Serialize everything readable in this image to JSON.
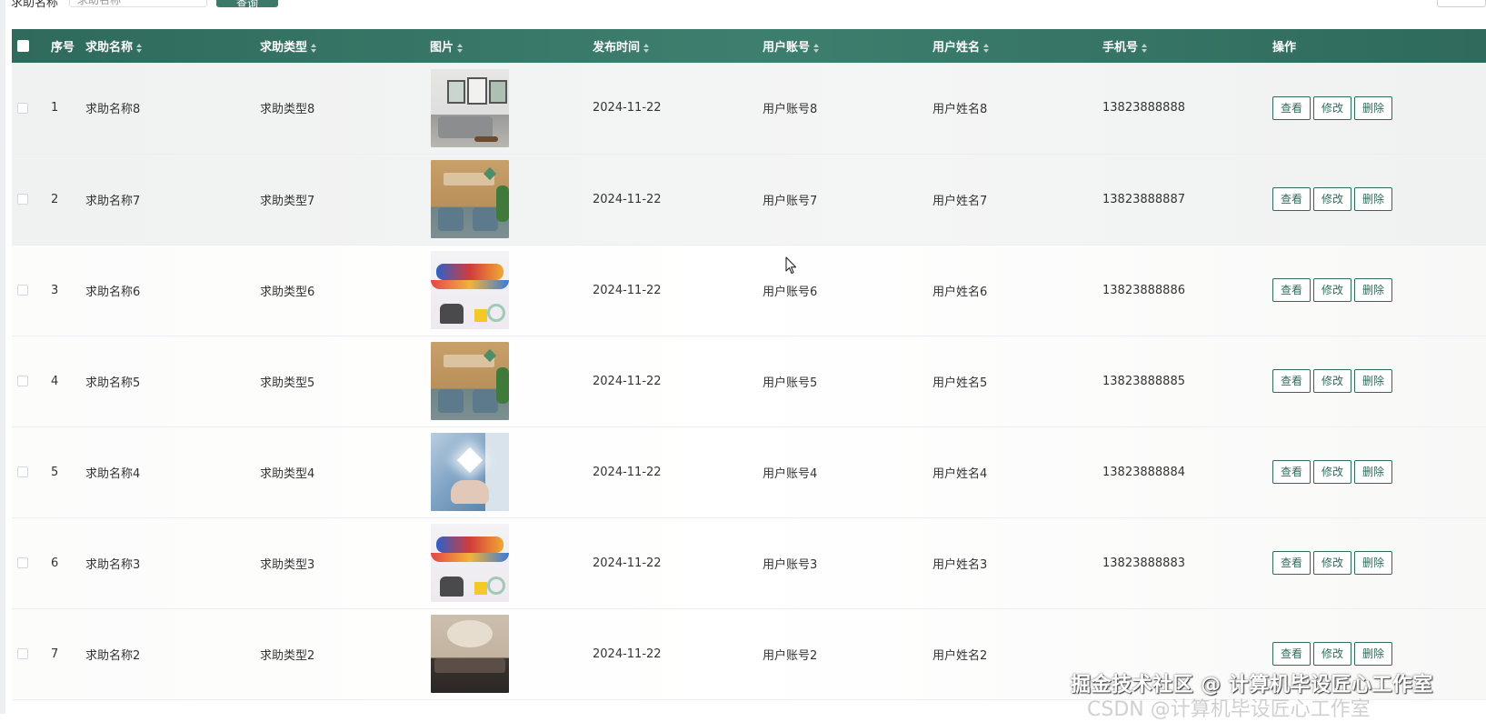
{
  "toolbar": {
    "search_label": "求助名称",
    "search_placeholder": "求助名称",
    "search_button": "查询"
  },
  "table": {
    "columns": [
      {
        "key": "index",
        "label": "序号",
        "sortable": false
      },
      {
        "key": "name",
        "label": "求助名称",
        "sortable": true
      },
      {
        "key": "type",
        "label": "求助类型",
        "sortable": true
      },
      {
        "key": "picture",
        "label": "图片",
        "sortable": true
      },
      {
        "key": "publish_time",
        "label": "发布时间",
        "sortable": true
      },
      {
        "key": "account",
        "label": "用户账号",
        "sortable": true
      },
      {
        "key": "username",
        "label": "用户姓名",
        "sortable": true
      },
      {
        "key": "phone",
        "label": "手机号",
        "sortable": true
      },
      {
        "key": "operations",
        "label": "操作",
        "sortable": false
      }
    ],
    "rows": [
      {
        "index": "1",
        "name": "求助名称8",
        "type": "求助类型8",
        "picture": "sofa-room-photo",
        "publish_time": "2024-11-22",
        "account": "用户账号8",
        "username": "用户姓名8",
        "phone": "13823888888"
      },
      {
        "index": "2",
        "name": "求助名称7",
        "type": "求助类型7",
        "picture": "armchairs-room-photo",
        "publish_time": "2024-11-22",
        "account": "用户账号7",
        "username": "用户姓名7",
        "phone": "13823888887"
      },
      {
        "index": "3",
        "name": "求助名称6",
        "type": "求助类型6",
        "picture": "colorful-room-photo",
        "publish_time": "2024-11-22",
        "account": "用户账号6",
        "username": "用户姓名6",
        "phone": "13823888886"
      },
      {
        "index": "4",
        "name": "求助名称5",
        "type": "求助类型5",
        "picture": "armchairs-room-photo",
        "publish_time": "2024-11-22",
        "account": "用户账号5",
        "username": "用户姓名5",
        "phone": "13823888885"
      },
      {
        "index": "5",
        "name": "求助名称4",
        "type": "求助类型4",
        "picture": "hand-heart-photo",
        "publish_time": "2024-11-22",
        "account": "用户账号4",
        "username": "用户姓名4",
        "phone": "13823888884"
      },
      {
        "index": "6",
        "name": "求助名称3",
        "type": "求助类型3",
        "picture": "colorful-room-photo",
        "publish_time": "2024-11-22",
        "account": "用户账号3",
        "username": "用户姓名3",
        "phone": "13823888883"
      },
      {
        "index": "7",
        "name": "求助名称2",
        "type": "求助类型2",
        "picture": "reception-photo",
        "publish_time": "2024-11-22",
        "account": "用户账号2",
        "username": "用户姓名2",
        "phone": ""
      }
    ],
    "actions": {
      "view": "查看",
      "edit": "修改",
      "delete": "删除"
    }
  },
  "watermark": {
    "text": "掘金技术社区 @ 计算机毕设匠心工作室",
    "sub_text": "CSDN @计算机毕设匠心工作室"
  },
  "colors": {
    "header_bg": "#2f6a5c",
    "accent": "#2f6a5c",
    "text": "#333333"
  },
  "icons": {
    "sort": "sort-caret-icon",
    "cursor": "mouse-pointer-icon"
  }
}
